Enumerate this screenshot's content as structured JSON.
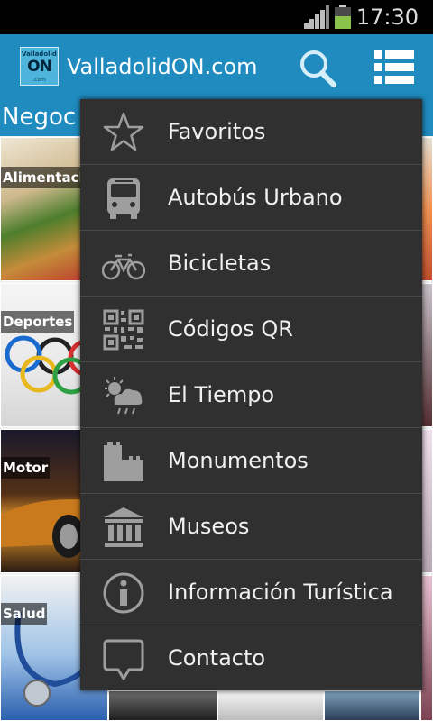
{
  "status_bar": {
    "time": "17:30"
  },
  "action_bar": {
    "logo": {
      "top": "Valladolid",
      "mid": "ON",
      "bottom": ".com"
    },
    "title": "ValladolidON.com"
  },
  "content": {
    "section_title": "Negoc",
    "tiles": [
      {
        "label": "Alimentaci"
      },
      {
        "label": "Deportes"
      },
      {
        "label": "Motor"
      },
      {
        "label": "Salud"
      }
    ]
  },
  "menu": {
    "items": [
      {
        "label": "Favoritos",
        "icon": "star-icon"
      },
      {
        "label": "Autobús Urbano",
        "icon": "bus-icon"
      },
      {
        "label": "Bicicletas",
        "icon": "bicycle-icon"
      },
      {
        "label": "Códigos QR",
        "icon": "qr-code-icon"
      },
      {
        "label": "El Tiempo",
        "icon": "weather-icon"
      },
      {
        "label": "Monumentos",
        "icon": "castle-icon"
      },
      {
        "label": "Museos",
        "icon": "museum-icon"
      },
      {
        "label": "Información Turística",
        "icon": "info-icon"
      },
      {
        "label": "Contacto",
        "icon": "speech-bubble-icon"
      }
    ]
  },
  "colors": {
    "action_bar": "#1f8bbf",
    "menu_background": "#303030",
    "menu_divider": "#4a4a4a",
    "menu_text": "#f0f0f0",
    "icon_gray": "#9e9e9e",
    "battery_green": "#8bc34a"
  }
}
